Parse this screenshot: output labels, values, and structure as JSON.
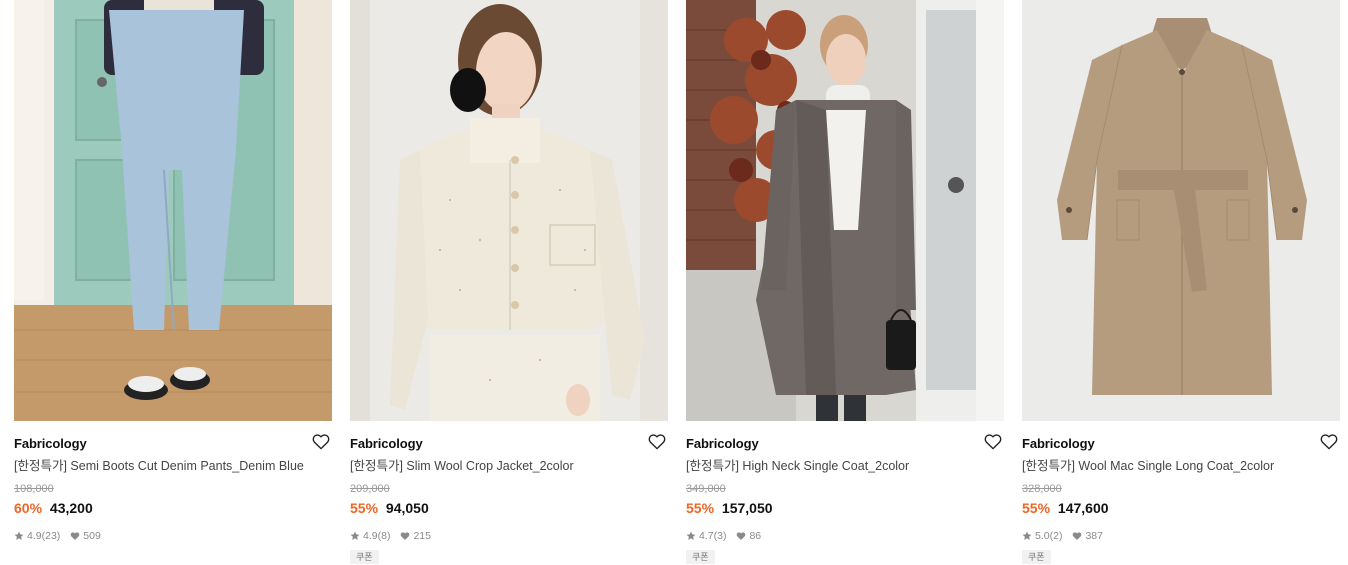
{
  "products": [
    {
      "brand": "Fabricology",
      "title": "[한정특가] Semi Boots Cut Denim Pants_Denim Blue",
      "original_price": "108,000",
      "discount": "60%",
      "price": "43,200",
      "rating": "4.9",
      "reviews": "(23)",
      "likes": "509",
      "coupon": ""
    },
    {
      "brand": "Fabricology",
      "title": "[한정특가] Slim Wool Crop Jacket_2color",
      "original_price": "209,000",
      "discount": "55%",
      "price": "94,050",
      "rating": "4.9",
      "reviews": "(8)",
      "likes": "215",
      "coupon": "쿠폰"
    },
    {
      "brand": "Fabricology",
      "title": "[한정특가] High Neck Single Coat_2color",
      "original_price": "349,000",
      "discount": "55%",
      "price": "157,050",
      "rating": "4.7",
      "reviews": "(3)",
      "likes": "86",
      "coupon": "쿠폰"
    },
    {
      "brand": "Fabricology",
      "title": "[한정특가] Wool Mac Single Long Coat_2color",
      "original_price": "328,000",
      "discount": "55%",
      "price": "147,600",
      "rating": "5.0",
      "reviews": "(2)",
      "likes": "387",
      "coupon": "쿠폰"
    }
  ],
  "icons": {
    "wishlist": "heart-outline-icon",
    "rating": "star-icon",
    "likes": "heart-filled-icon"
  },
  "colors": {
    "discount": "#f06524",
    "muted": "#8a8a8a"
  }
}
